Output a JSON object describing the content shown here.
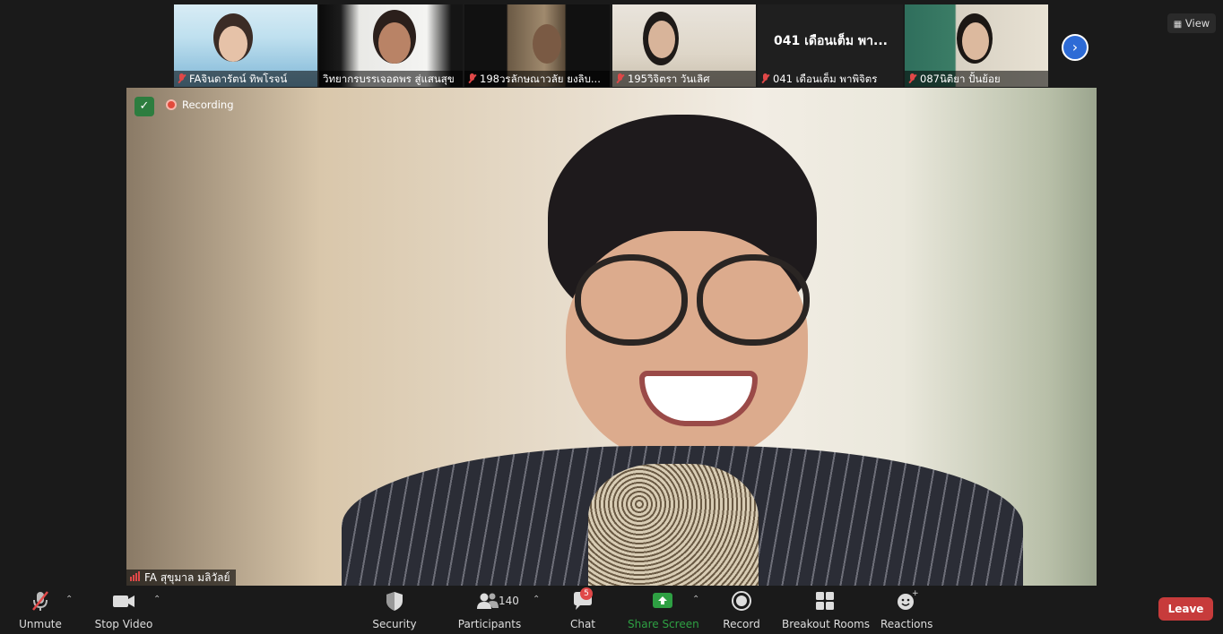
{
  "thumbnails": [
    {
      "name": "FAจินดารัตน์ ทิพโรจน์",
      "muted": true
    },
    {
      "name": "วิทยากรบรรเจอดพร สู่แสนสุข",
      "muted": false
    },
    {
      "name": "198วรลักษณาวลัย ยงลิบ...",
      "muted": true
    },
    {
      "name": "195วิจิตรา วันเลิศ",
      "muted": true
    },
    {
      "name": "041 เดือนเต็ม พาพิจิตร",
      "tile_text": "041 เดือนเต็ม พา...",
      "muted": true
    },
    {
      "name": "087นิติยา ปั้นย้อย",
      "muted": true
    }
  ],
  "view_button": "View",
  "next_icon": "chevron-right-icon",
  "recording_label": "Recording",
  "active_speaker": "FA สุขุมาล มลิวัลย์",
  "toolbar": {
    "unmute": "Unmute",
    "stop_video": "Stop Video",
    "security": "Security",
    "participants": "Participants",
    "participants_count": "140",
    "chat": "Chat",
    "chat_badge": "5",
    "share_screen": "Share Screen",
    "record": "Record",
    "breakout_rooms": "Breakout Rooms",
    "reactions": "Reactions",
    "leave": "Leave"
  },
  "colors": {
    "accent_green": "#2ea043",
    "leave_red": "#c73b3b",
    "next_blue": "#2d6bd6",
    "muted_red": "#e04848"
  }
}
